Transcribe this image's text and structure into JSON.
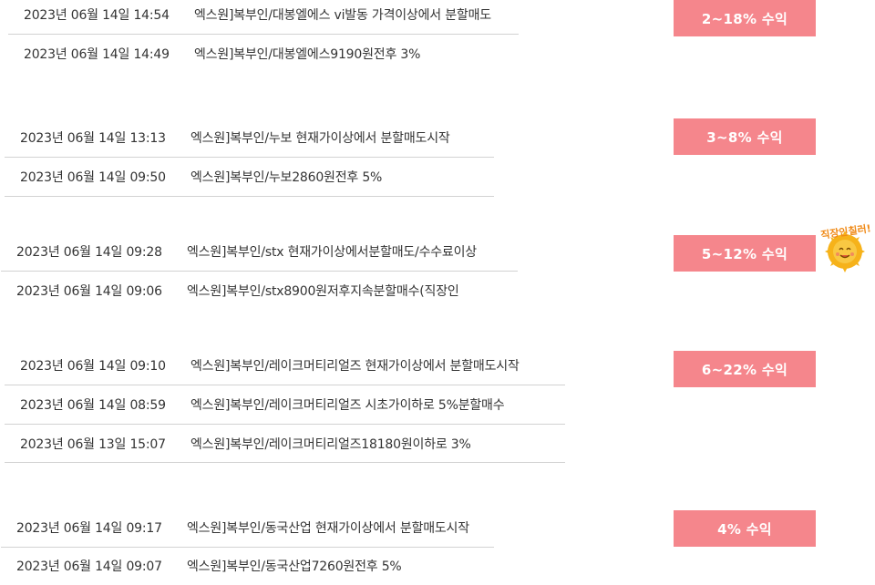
{
  "groups": [
    {
      "badge": "2~18% 수익",
      "rows": [
        {
          "date": "2023년 06월 14일 14:54",
          "msg": "엑스원]복부인/대봉엘에스 vi발동 가격이상에서 분할매도"
        },
        {
          "date": "2023년 06월 14일 14:49",
          "msg": "엑스원]복부인/대봉엘에스9190원전후 3%"
        }
      ]
    },
    {
      "badge": "3~8% 수익",
      "rows": [
        {
          "date": "2023년 06월 14일 13:13",
          "msg": "엑스원]복부인/누보 현재가이상에서 분할매도시작"
        },
        {
          "date": "2023년 06월 14일 09:50",
          "msg": "엑스원]복부인/누보2860원전후 5%"
        }
      ]
    },
    {
      "badge": "5~12% 수익",
      "rows": [
        {
          "date": "2023년 06월 14일 09:28",
          "msg": "엑스원]복부인/stx 현재가이상에서분할매도/수수료이상"
        },
        {
          "date": "2023년 06월 14일 09:06",
          "msg": "엑스원]복부인/stx8900원저후지속분할매수(직장인"
        }
      ]
    },
    {
      "badge": "6~22% 수익",
      "rows": [
        {
          "date": "2023년 06월 14일 09:10",
          "msg": "엑스원]복부인/레이크머티리얼즈 현재가이상에서 분할매도시작"
        },
        {
          "date": "2023년 06월 14일 08:59",
          "msg": "엑스원]복부인/레이크머티리얼즈 시초가이하로 5%분할매수"
        },
        {
          "date": "2023년 06월 13일 15:07",
          "msg": "엑스원]복부인/레이크머티리얼즈18180원이하로 3%"
        }
      ]
    },
    {
      "badge": "4% 수익",
      "rows": [
        {
          "date": "2023년 06월 14일 09:17",
          "msg": "엑스원]복부인/동국산업 현재가이상에서 분할매도시작"
        },
        {
          "date": "2023년 06월 14일 09:07",
          "msg": "엑스원]복부인/동국산업7260원전후 5%"
        }
      ]
    }
  ],
  "mascot": {
    "caption": "직장인칠러!",
    "icon": "smiling-sun-mascot-icon",
    "color": "#f6b21a"
  },
  "colors": {
    "badge": "#f5868c",
    "rule": "#d2d2d2",
    "text": "#333333"
  }
}
